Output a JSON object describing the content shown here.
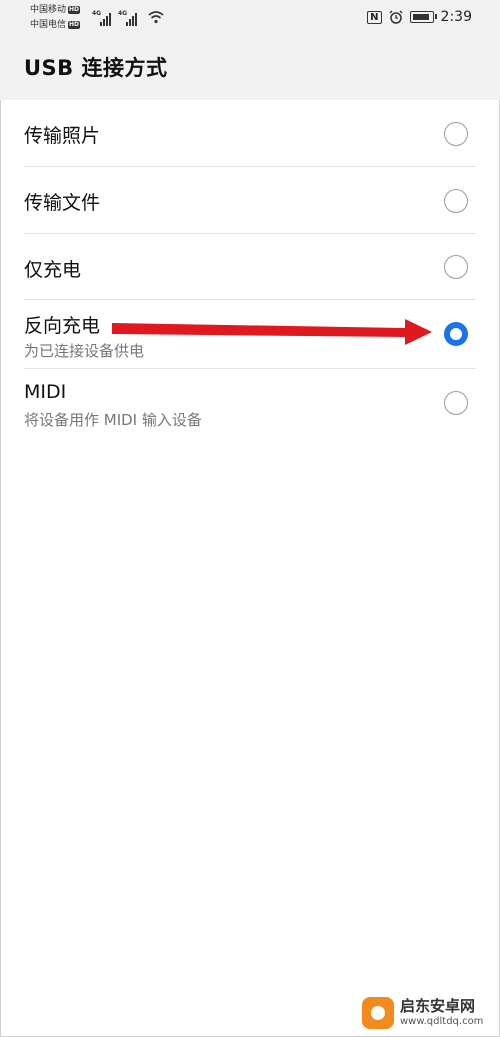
{
  "status_bar": {
    "carrier1": "中国移动",
    "carrier2": "中国电信",
    "hd": "HD",
    "net1": "4G",
    "net2": "4G",
    "time": "2:39",
    "nfc": "N",
    "icons": [
      "nfc-icon",
      "alarm-icon",
      "battery-icon",
      "wifi-icon",
      "signal-icon"
    ]
  },
  "header": {
    "title": "USB 连接方式"
  },
  "options": [
    {
      "label": "传输照片",
      "sub": "",
      "selected": false
    },
    {
      "label": "传输文件",
      "sub": "",
      "selected": false
    },
    {
      "label": "仅充电",
      "sub": "",
      "selected": false
    },
    {
      "label": "反向充电",
      "sub": "为已连接设备供电",
      "selected": true
    },
    {
      "label": "MIDI",
      "sub": "将设备用作 MIDI 输入设备",
      "selected": false
    }
  ],
  "colors": {
    "accent": "#1a73e8",
    "arrow": "#e0191f",
    "header_bg": "#f1f1f1"
  },
  "watermark": {
    "name": "启东安卓网",
    "url": "www.qdltdq.com"
  }
}
